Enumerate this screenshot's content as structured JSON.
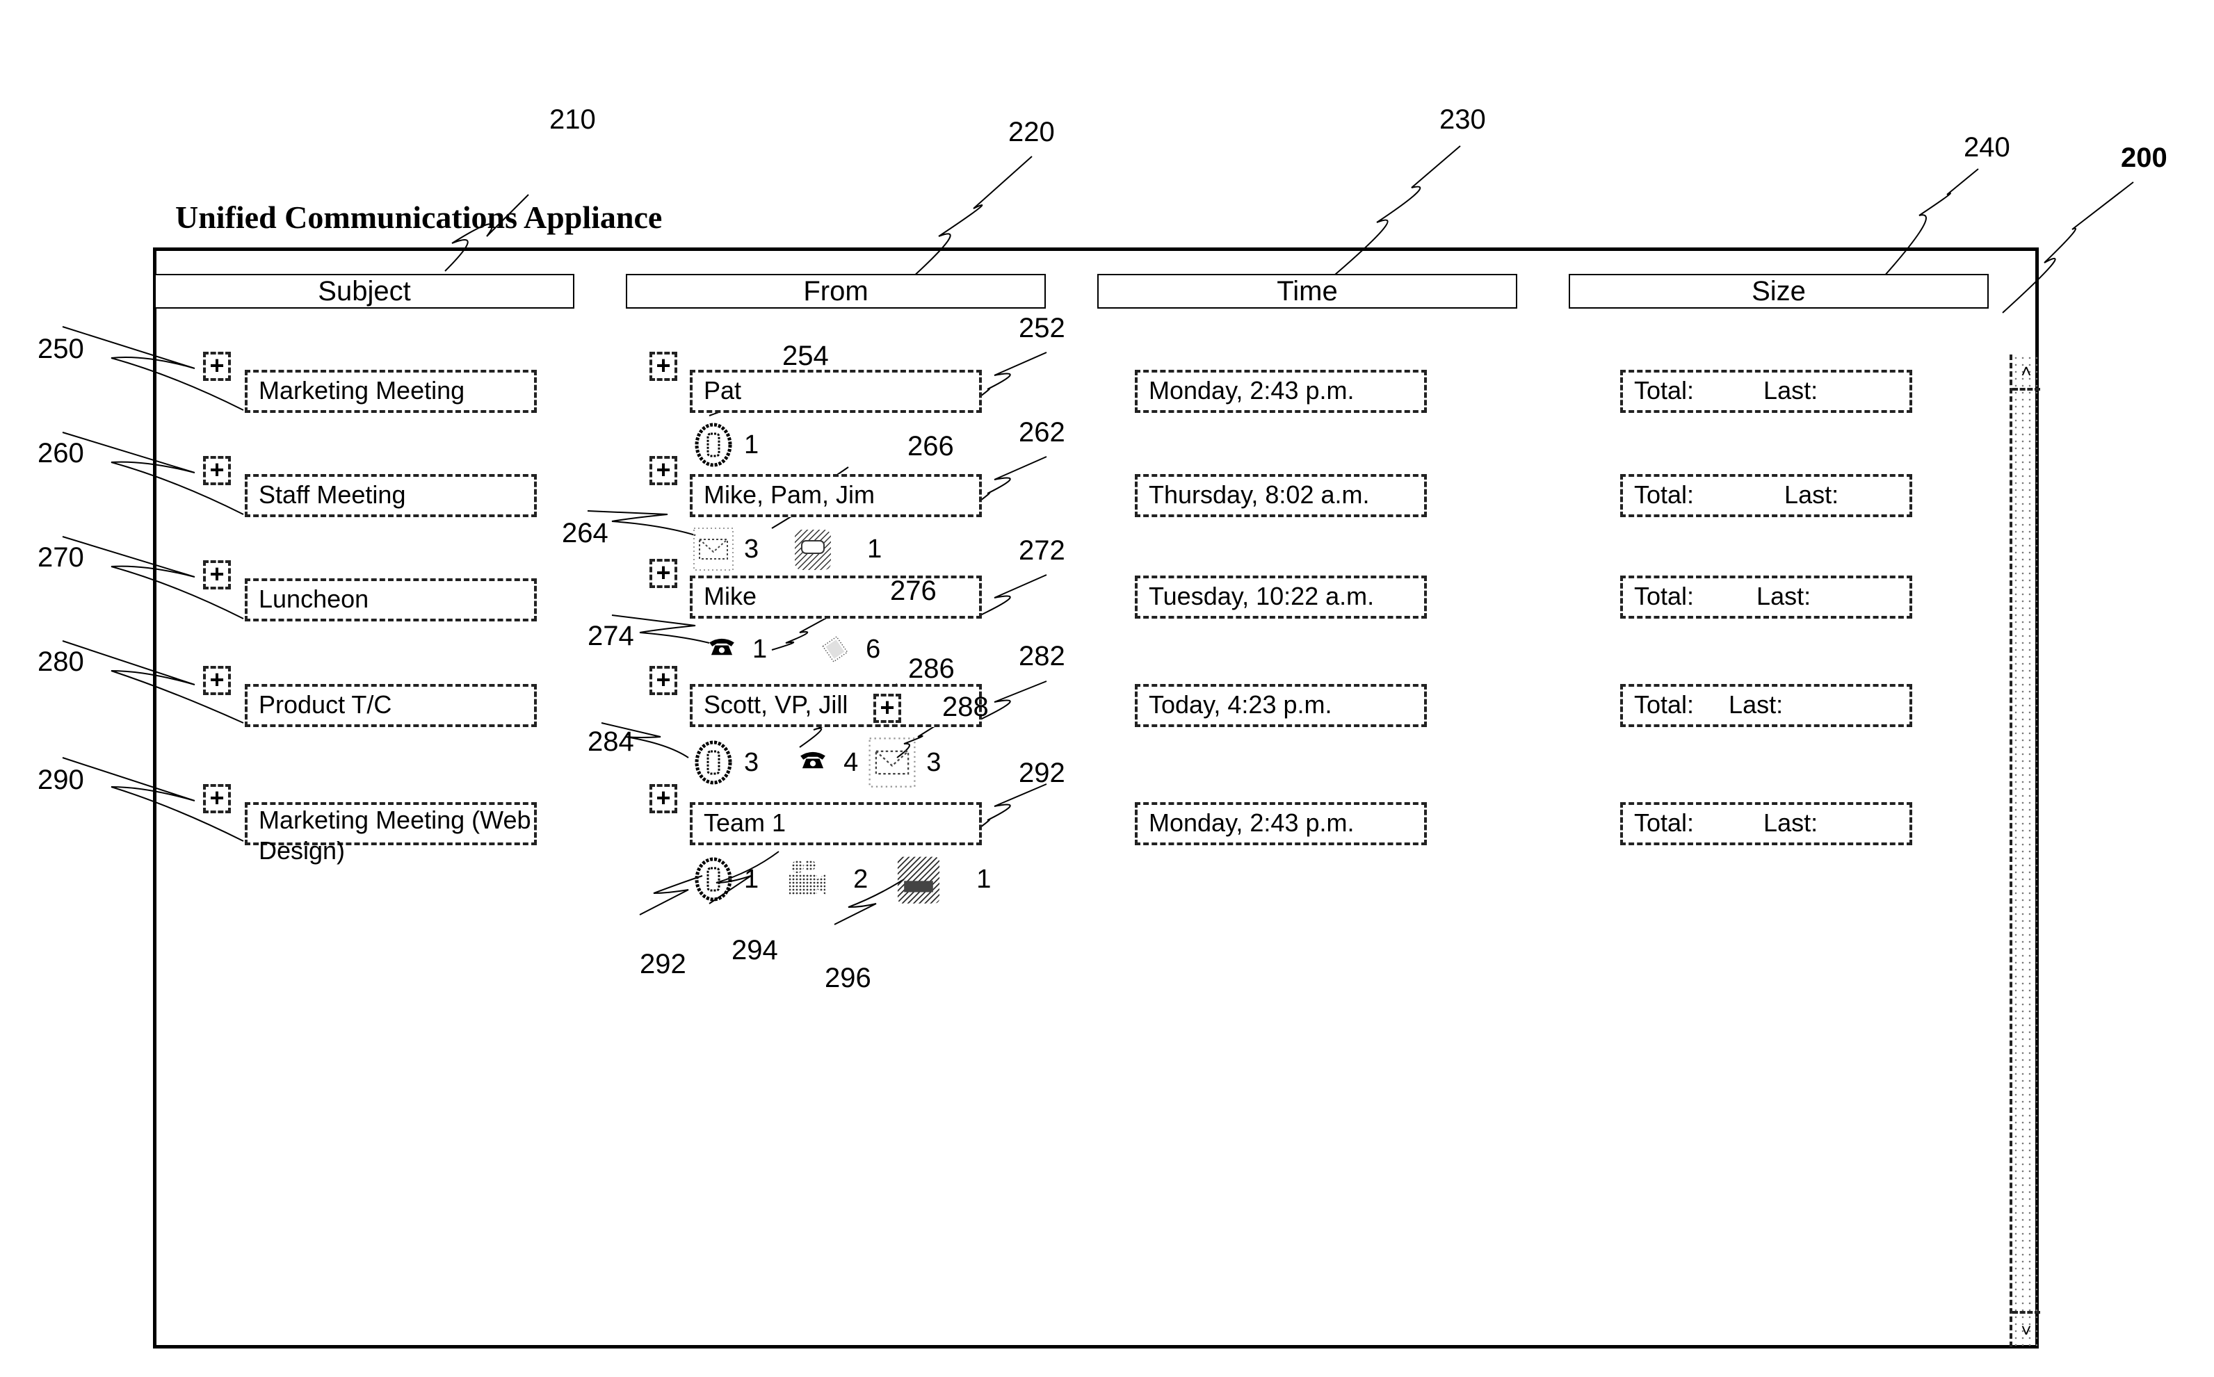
{
  "app": {
    "title": "Unified Communications Appliance"
  },
  "columns": [
    {
      "label": "Subject",
      "ref": "210"
    },
    {
      "label": "From",
      "ref": "220"
    },
    {
      "label": "Time",
      "ref": "230"
    },
    {
      "label": "Size",
      "ref": "240"
    }
  ],
  "figure_ref": "200",
  "rows": [
    {
      "ref": "250",
      "subject": "Marketing Meeting",
      "from": "Pat",
      "from_ref": "252",
      "time": "Monday, 2:43 p.m.",
      "size_total_label": "Total:",
      "size_last_label": "Last:",
      "icons": [
        {
          "icon": "cell-phone-icon",
          "count": "1",
          "ref": "254"
        }
      ]
    },
    {
      "ref": "260",
      "subject": "Staff Meeting",
      "from": "Mike, Pam, Jim",
      "from_ref": "262",
      "time": "Thursday, 8:02 a.m.",
      "size_total_label": "Total:",
      "size_last_label": "Last:",
      "icons": [
        {
          "icon": "email-icon",
          "count": "3",
          "ref": "264"
        },
        {
          "icon": "instant-message-icon",
          "count": "1",
          "ref": "266"
        }
      ]
    },
    {
      "ref": "270",
      "subject": "Luncheon",
      "from": "Mike",
      "from_ref": "272",
      "time": "Tuesday, 10:22 a.m.",
      "size_total_label": "Total:",
      "size_last_label": "Last:",
      "icons": [
        {
          "icon": "desk-phone-icon",
          "count": "1",
          "ref": "274"
        },
        {
          "icon": "fax-document-icon",
          "count": "6",
          "ref": "276"
        }
      ]
    },
    {
      "ref": "280",
      "subject": "Product T/C",
      "from": "Scott, VP, Jill",
      "from_ref": "282",
      "time": "Today, 4:23 p.m.",
      "size_total_label": "Total:",
      "size_last_label": "Last:",
      "from_expand_ref": "286",
      "icons": [
        {
          "icon": "cell-phone-icon",
          "count": "3",
          "ref": "284"
        },
        {
          "icon": "desk-phone-icon",
          "count": "4",
          "ref": "286"
        },
        {
          "icon": "email-icon",
          "count": "3",
          "ref": "288"
        }
      ]
    },
    {
      "ref": "290",
      "subject": "Marketing Meeting (Web Design)",
      "from": "Team 1",
      "from_ref": "292",
      "time": "Monday, 2:43 p.m.",
      "size_total_label": "Total:",
      "size_last_label": "Last:",
      "icons": [
        {
          "icon": "cell-phone-icon",
          "count": "1",
          "ref": "292"
        },
        {
          "icon": "video-camera-icon",
          "count": "2",
          "ref": "294"
        },
        {
          "icon": "video-conference-icon",
          "count": "1",
          "ref": "296"
        }
      ]
    }
  ],
  "scrollbar": {
    "up_glyph": "˄",
    "down_glyph": "˅"
  }
}
